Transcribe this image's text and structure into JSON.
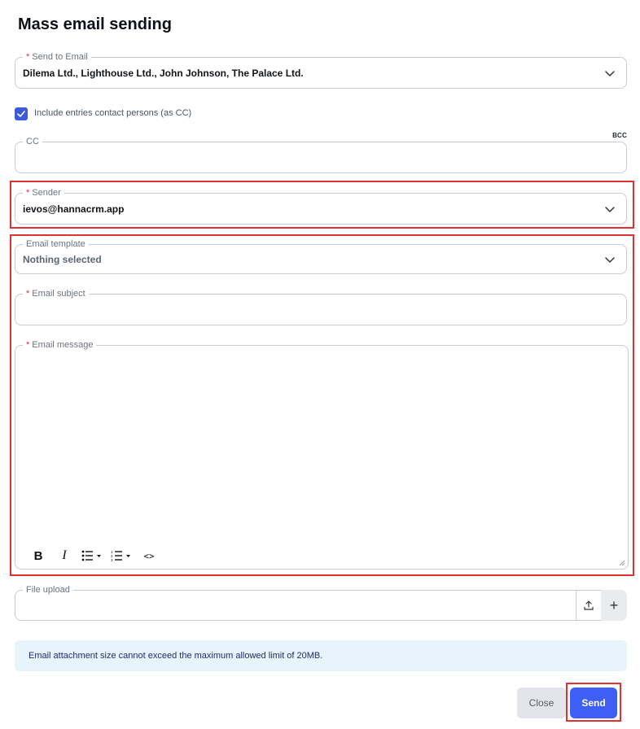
{
  "dialog": {
    "title": "Mass email sending"
  },
  "send_to": {
    "label": "Send to Email",
    "required_mark": "*",
    "value": "Dilema Ltd., Lighthouse Ltd., John Johnson, The Palace Ltd."
  },
  "include_contacts": {
    "checked": true,
    "label": "Include entries contact persons (as CC)"
  },
  "cc": {
    "label": "CC",
    "value": "",
    "bcc_label": "BCC"
  },
  "sender": {
    "label": "Sender",
    "required_mark": "*",
    "value": "ievos@hannacrm.app"
  },
  "template": {
    "label": "Email template",
    "value": "Nothing selected"
  },
  "subject": {
    "label": "Email subject",
    "required_mark": "*",
    "value": ""
  },
  "message": {
    "label": "Email message",
    "required_mark": "*",
    "value": "",
    "toolbar": {
      "bold": "B",
      "italic": "I",
      "code": "<>"
    }
  },
  "file_upload": {
    "label": "File upload",
    "plus": "+"
  },
  "info_text": "Email attachment size cannot exceed the maximum allowed limit of 20MB.",
  "buttons": {
    "close": "Close",
    "send": "Send"
  },
  "colors": {
    "accent": "#3f5ef6",
    "highlight": "#e03131",
    "info_bg": "#e8f4fc"
  }
}
